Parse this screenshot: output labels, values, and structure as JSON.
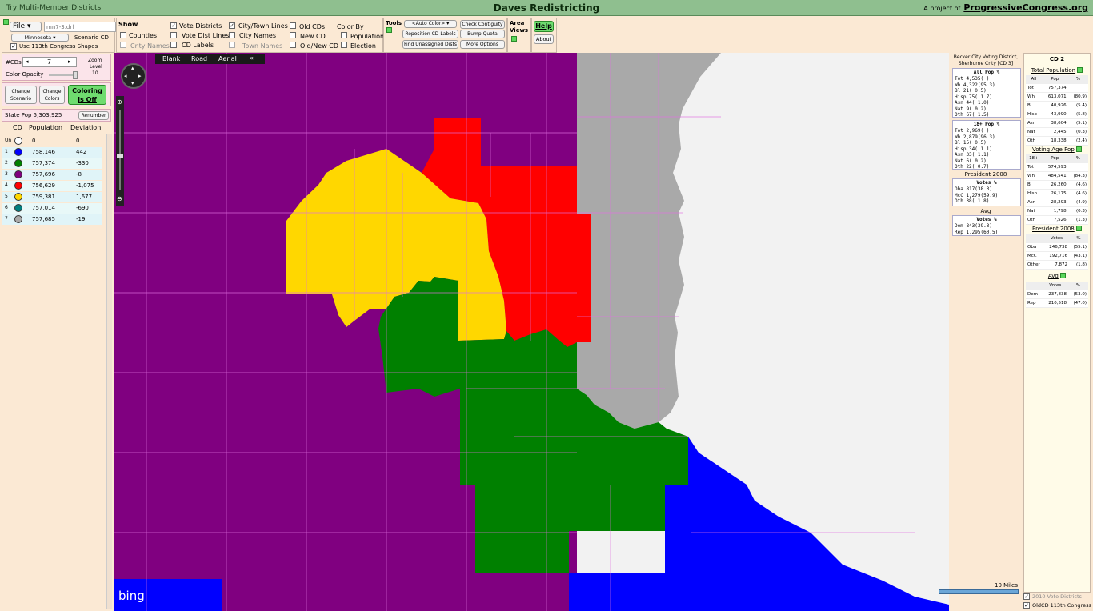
{
  "titlebar": {
    "left": "Try Multi-Member Districts",
    "title": "Daves Redistricting",
    "project_prefix": "A project of",
    "project_link": "ProgressiveCongress.org"
  },
  "file": {
    "menu": "File",
    "filename_placeholder": "mn7-3.drf",
    "state": "Minnesota",
    "scenario": "Scenario CD",
    "use113": "Use 113th Congress Shapes"
  },
  "show": {
    "heading": "Show",
    "counties": "Counties",
    "cnty_names": "Cnty Names",
    "vote_districts": "Vote Districts",
    "vote_dist_lines": "Vote Dist Lines",
    "cd_labels": "CD Labels",
    "city_town_lines": "City/Town Lines",
    "city_names": "City Names",
    "town_names": "Town Names",
    "old_cds": "Old CDs",
    "new_cd": "New CD",
    "old_new_cd": "Old/New CD",
    "color_by": "Color By",
    "population": "Population",
    "election": "Election"
  },
  "tools": {
    "heading": "Tools",
    "auto_color": "<Auto Color>",
    "reposition": "Reposition CD Labels",
    "find_unassigned": "Find Unassigned Dists",
    "check_contiguity": "Check Contiguity",
    "bump_quota": "Bump Quota",
    "more_options": "More Options"
  },
  "area_views": {
    "label1": "Area",
    "label2": "Views"
  },
  "help": {
    "help": "Help",
    "about": "About"
  },
  "left": {
    "num_cds_label": "#CDs",
    "num_cds": "7",
    "zoom_label1": "Zoom",
    "zoom_label2": "Level",
    "zoom_value": "10",
    "color_opacity": "Color Opacity",
    "change_scenario": "Change Scenario",
    "change_colors": "Change Colors",
    "coloring": "Coloring Is Off",
    "state_pop": "State Pop  5,303,925",
    "renumber": "Renumber",
    "headers": [
      "CD",
      "Population",
      "Deviation"
    ],
    "rows": [
      {
        "cd": "Un",
        "pop": "0",
        "dev": "0",
        "color": "#ffffff"
      },
      {
        "cd": "1",
        "pop": "758,146",
        "dev": "442",
        "color": "#0000ff"
      },
      {
        "cd": "2",
        "pop": "757,374",
        "dev": "-330",
        "color": "#008000"
      },
      {
        "cd": "3",
        "pop": "757,696",
        "dev": "-8",
        "color": "#800080"
      },
      {
        "cd": "4",
        "pop": "756,629",
        "dev": "-1,075",
        "color": "#ff0000"
      },
      {
        "cd": "5",
        "pop": "759,381",
        "dev": "1,677",
        "color": "#ffd700"
      },
      {
        "cd": "6",
        "pop": "757,014",
        "dev": "-690",
        "color": "#008080"
      },
      {
        "cd": "7",
        "pop": "757,685",
        "dev": "-19",
        "color": "#a9a9a9"
      }
    ]
  },
  "map": {
    "tabs": [
      "Blank",
      "Road",
      "Aerial"
    ],
    "collapse": "«",
    "bing": "bing",
    "scale": "10 Miles",
    "colors": {
      "purple": "#800080",
      "yellow": "#ffd700",
      "red": "#ff0000",
      "gray": "#a9a9a9",
      "green": "#008000",
      "blue": "#0000ff",
      "bg": "#f2f2f2"
    }
  },
  "precinct": {
    "title1": "Becker City Voting District,",
    "title2": "Sherburne Cnty [CD 3]",
    "all_pop_head": "All Pop      %",
    "all_pop": [
      "Tot    4,535(   )",
      "Wh     4,322(95.3)",
      "Bl        21( 0.5)",
      "Hisp      75( 1.7)",
      "Asn       44( 1.0)",
      "Nat        9( 0.2)",
      "Oth       67( 1.5)"
    ],
    "p18_head": "18+ Pop      %",
    "p18": [
      "Tot    2,969(   )",
      "Wh     2,879(96.3)",
      "Bl        15( 0.5)",
      "Hisp      34( 1.1)",
      "Asn       33( 1.1)",
      "Nat        6( 0.2)",
      "Oth       22( 0.7)"
    ],
    "pres_title": "President 2008",
    "pres_head": "Votes      %",
    "pres": [
      "Oba      817(38.3)",
      "McC    1,279(59.9)",
      "Oth       38( 1.8)"
    ],
    "avg_title": "Avg",
    "avg_head": "Votes      %",
    "avg": [
      "Dem      843(39.3)",
      "Rep    1,295(60.5)"
    ]
  },
  "cd_panel": {
    "title": "CD 2",
    "total_pop_title": "Total Population",
    "total_head": [
      "All",
      "Pop",
      "%"
    ],
    "total": [
      [
        "Tot",
        "757,374",
        ""
      ],
      [
        "Wh",
        "613,071",
        "(80.9)"
      ],
      [
        "Bl",
        "40,926",
        "(5.4)"
      ],
      [
        "Hisp",
        "43,990",
        "(5.8)"
      ],
      [
        "Asn",
        "38,604",
        "(5.1)"
      ],
      [
        "Nat",
        "2,445",
        "(0.3)"
      ],
      [
        "Oth",
        "18,338",
        "(2.4)"
      ]
    ],
    "vap_title": "Voting Age Pop",
    "vap_head": [
      "18+",
      "Pop",
      "%"
    ],
    "vap": [
      [
        "Tot",
        "574,593",
        ""
      ],
      [
        "Wh",
        "484,541",
        "(84.3)"
      ],
      [
        "Bl",
        "26,260",
        "(4.6)"
      ],
      [
        "Hisp",
        "26,175",
        "(4.6)"
      ],
      [
        "Asn",
        "28,293",
        "(4.9)"
      ],
      [
        "Nat",
        "1,798",
        "(0.3)"
      ],
      [
        "Oth",
        "7,526",
        "(1.3)"
      ]
    ],
    "pres_title": "President 2008",
    "pres_head": [
      "",
      "Votes",
      "%"
    ],
    "pres": [
      [
        "Oba",
        "246,738",
        "(55.1)"
      ],
      [
        "McC",
        "192,716",
        "(43.1)"
      ],
      [
        "Other",
        "7,872",
        "(1.8)"
      ]
    ],
    "avg_title": "Avg",
    "avg_head": [
      "",
      "Votes",
      "%"
    ],
    "avg": [
      [
        "Dem",
        "237,838",
        "(53.0)"
      ],
      [
        "Rep",
        "210,518",
        "(47.0)"
      ]
    ],
    "vote_districts_2010": "2010 Vote Districts",
    "old_cd_113": "OldCD 113th Congress"
  }
}
